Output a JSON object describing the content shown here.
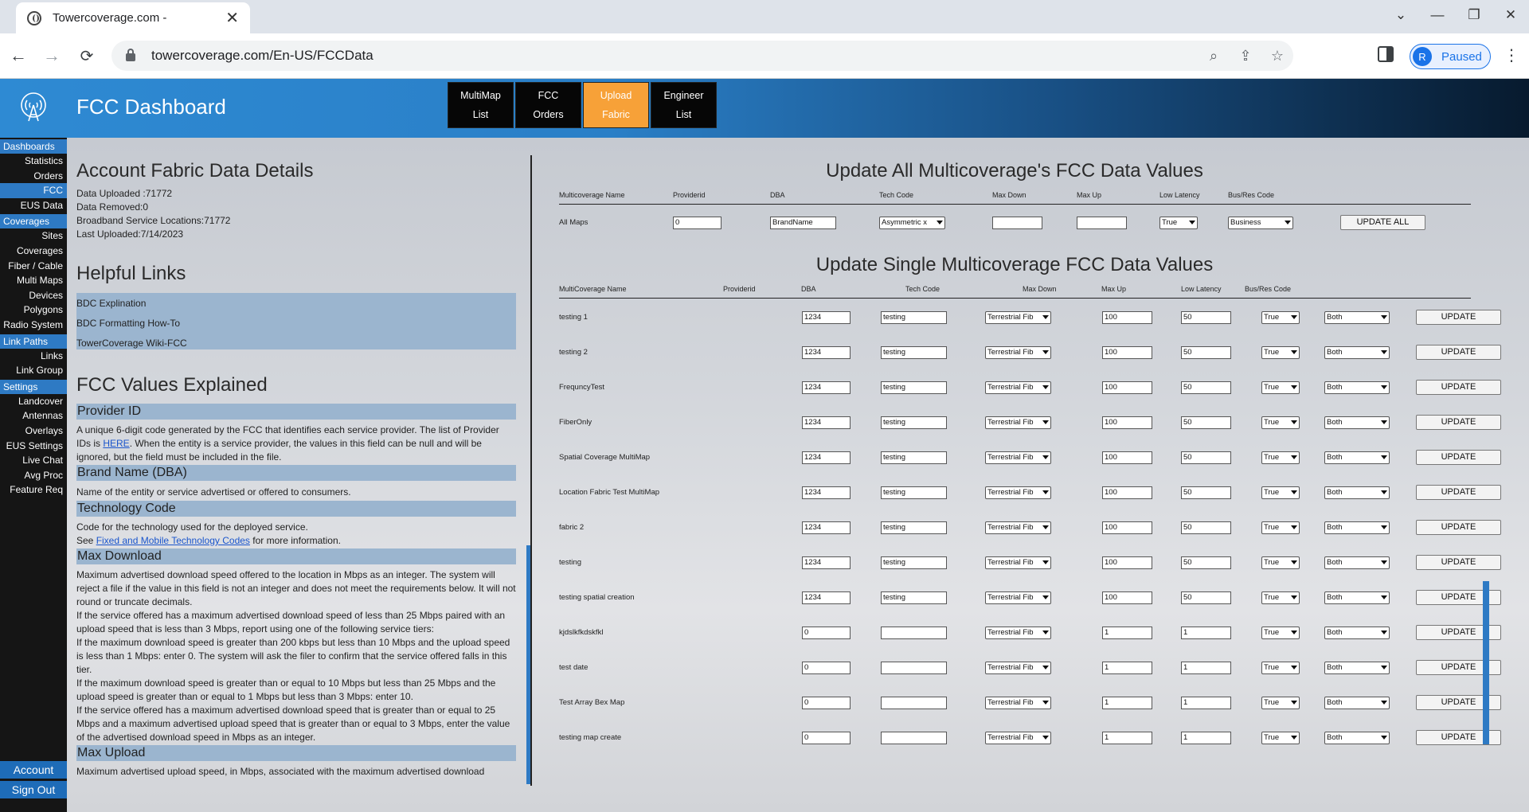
{
  "browser": {
    "tab_title": "Towercoverage.com -",
    "url": "towercoverage.com/En-US/FCCData",
    "profile_initial": "R",
    "profile_label": "Paused"
  },
  "header": {
    "title": "FCC Dashboard",
    "nav": [
      {
        "line1": "MultiMap",
        "line2": "List",
        "active": false
      },
      {
        "line1": "FCC",
        "line2": "Orders",
        "active": false
      },
      {
        "line1": "Upload",
        "line2": "Fabric",
        "active": true
      },
      {
        "line1": "Engineer",
        "line2": "List",
        "active": false
      }
    ]
  },
  "sidebar": {
    "sections": [
      {
        "label": "Dashboards",
        "items": [
          "Statistics",
          "Orders",
          "FCC",
          "EUS Data"
        ]
      },
      {
        "label": "Coverages",
        "items": [
          "Sites",
          "Coverages",
          "Fiber / Cable",
          "Multi Maps",
          "Devices",
          "Polygons",
          "Radio System"
        ]
      },
      {
        "label": "Link Paths",
        "items": [
          "Links",
          "Link Group"
        ]
      },
      {
        "label": "Settings",
        "items": [
          "Landcover",
          "Antennas",
          "Overlays",
          "EUS Settings",
          "Live Chat",
          "Avg Proc",
          "Feature Req"
        ]
      }
    ],
    "active_item": "FCC",
    "account_label": "Account",
    "signout_label": "Sign Out"
  },
  "left": {
    "account_title": "Account Fabric Data Details",
    "details": [
      "Data Uploaded :71772",
      "Data Removed:0",
      "Broadband Service Locations:71772",
      "Last Uploaded:7/14/2023"
    ],
    "links_title": "Helpful Links",
    "links": [
      "BDC Explination",
      "BDC Formatting How-To",
      "TowerCoverage Wiki-FCC"
    ],
    "values_title": "FCC Values Explained",
    "provider_id": {
      "title": "Provider ID",
      "text_before": "A unique 6-digit code generated by the FCC that identifies each service provider. The list of Provider IDs is ",
      "link": "HERE",
      "text_after": ". When the entity is a service provider, the values in this field can be null and will be ignored, but the field must be included in the file."
    },
    "brand_name": {
      "title": "Brand Name (DBA)",
      "text": "Name of the entity or service advertised or offered to consumers."
    },
    "tech_code": {
      "title": "Technology Code",
      "text1": "Code for the technology used for the deployed service.",
      "see": "See ",
      "link": "Fixed and Mobile Technology Codes",
      "text2": " for more information."
    },
    "max_download": {
      "title": "Max Download",
      "text": "Maximum advertised download speed offered to the location in Mbps as an integer. The system will reject a file if the value in this field is not an integer and does not meet the requirements below. It will not round or truncate decimals.",
      "tier_intro": "If the service offered has a maximum advertised download speed of less than 25 Mbps paired with an upload speed that is less than 3 Mbps, report using one of the following service tiers:",
      "tier1": "If the maximum download speed is greater than 200 kbps but less than 10 Mbps and the upload speed is less than 1 Mbps: enter 0. The system will ask the filer to confirm that the service offered falls in this tier.",
      "tier2": "If the maximum download speed is greater than or equal to 10 Mbps but less than 25 Mbps and the upload speed is greater than or equal to 1 Mbps but less than 3 Mbps: enter 10.",
      "tier3": "If the service offered has a maximum advertised download speed that is greater than or equal to 25 Mbps and a maximum advertised upload speed that is greater than or equal to 3 Mbps, enter the value of the advertised download speed in Mbps as an integer."
    },
    "max_upload": {
      "title": "Max Upload",
      "text": "Maximum advertised upload speed, in Mbps, associated with the maximum advertised download"
    }
  },
  "right": {
    "all_title": "Update All Multicoverage's FCC Data Values",
    "all_headers": [
      "Multicoverage Name",
      "Providerid",
      "DBA",
      "Tech Code",
      "Max Down",
      "Max Up",
      "Low Latency",
      "Bus/Res Code"
    ],
    "all_row": {
      "name": "All Maps",
      "provider": "0",
      "dba": "BrandName",
      "tech": "Asymmetric x",
      "down": "",
      "up": "",
      "latency": "True",
      "busres": "Business",
      "button": "UPDATE ALL"
    },
    "single_title": "Update Single Multicoverage FCC Data Values",
    "single_headers": [
      "MultiCoverage Name",
      "Providerid",
      "DBA",
      "Tech Code",
      "Max Down",
      "Max Up",
      "Low Latency",
      "Bus/Res Code"
    ],
    "rows": [
      {
        "name": "testing 1",
        "provider": "1234",
        "dba": "testing",
        "tech": "Terrestrial Fib",
        "down": "100",
        "up": "50",
        "latency": "True",
        "busres": "Both"
      },
      {
        "name": "testing 2",
        "provider": "1234",
        "dba": "testing",
        "tech": "Terrestrial Fib",
        "down": "100",
        "up": "50",
        "latency": "True",
        "busres": "Both"
      },
      {
        "name": "FrequncyTest",
        "provider": "1234",
        "dba": "testing",
        "tech": "Terrestrial Fib",
        "down": "100",
        "up": "50",
        "latency": "True",
        "busres": "Both"
      },
      {
        "name": "FiberOnly",
        "provider": "1234",
        "dba": "testing",
        "tech": "Terrestrial Fib",
        "down": "100",
        "up": "50",
        "latency": "True",
        "busres": "Both"
      },
      {
        "name": "Spatial Coverage MultiMap",
        "provider": "1234",
        "dba": "testing",
        "tech": "Terrestrial Fib",
        "down": "100",
        "up": "50",
        "latency": "True",
        "busres": "Both"
      },
      {
        "name": "Location Fabric Test MultiMap",
        "provider": "1234",
        "dba": "testing",
        "tech": "Terrestrial Fib",
        "down": "100",
        "up": "50",
        "latency": "True",
        "busres": "Both"
      },
      {
        "name": "fabric 2",
        "provider": "1234",
        "dba": "testing",
        "tech": "Terrestrial Fib",
        "down": "100",
        "up": "50",
        "latency": "True",
        "busres": "Both"
      },
      {
        "name": "testing",
        "provider": "1234",
        "dba": "testing",
        "tech": "Terrestrial Fib",
        "down": "100",
        "up": "50",
        "latency": "True",
        "busres": "Both"
      },
      {
        "name": "testing spatial creation",
        "provider": "1234",
        "dba": "testing",
        "tech": "Terrestrial Fib",
        "down": "100",
        "up": "50",
        "latency": "True",
        "busres": "Both"
      },
      {
        "name": "kjdslkfkdskfkl",
        "provider": "0",
        "dba": "",
        "tech": "Terrestrial Fib",
        "down": "1",
        "up": "1",
        "latency": "True",
        "busres": "Both"
      },
      {
        "name": "test date",
        "provider": "0",
        "dba": "",
        "tech": "Terrestrial Fib",
        "down": "1",
        "up": "1",
        "latency": "True",
        "busres": "Both"
      },
      {
        "name": "Test Array Bex Map",
        "provider": "0",
        "dba": "",
        "tech": "Terrestrial Fib",
        "down": "1",
        "up": "1",
        "latency": "True",
        "busres": "Both"
      },
      {
        "name": "testing map create",
        "provider": "0",
        "dba": "",
        "tech": "Terrestrial Fib",
        "down": "1",
        "up": "1",
        "latency": "True",
        "busres": "Both"
      }
    ],
    "row_button": "UPDATE"
  }
}
